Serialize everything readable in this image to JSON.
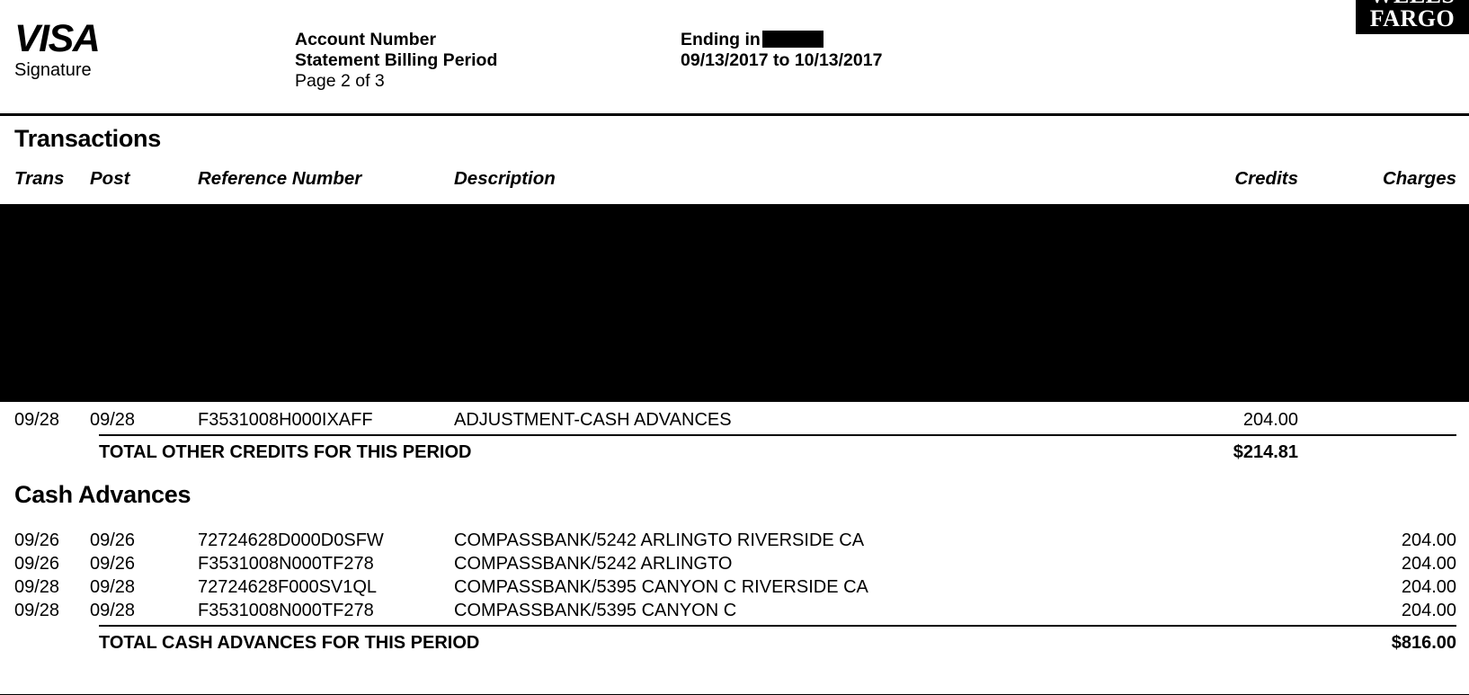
{
  "header": {
    "brand_logo": "visa-signature",
    "visa_wordmark": "VISA",
    "visa_sub": "Signature",
    "labels": {
      "account_number": "Account Number",
      "billing_period": "Statement Billing Period",
      "page": "Page 2 of 3"
    },
    "values": {
      "ending_in_label": "Ending in",
      "ending_in_value": "",
      "date_range": "09/13/2017 to 10/13/2017"
    },
    "bank_logo_line1": "WELLS",
    "bank_logo_line2": "FARGO"
  },
  "transactions_section": {
    "title": "Transactions",
    "columns": {
      "trans": "Trans",
      "post": "Post",
      "reference": "Reference Number",
      "description": "Description",
      "credits": "Credits",
      "charges": "Charges"
    },
    "redacted_rows_note": "",
    "rows": [
      {
        "trans": "09/28",
        "post": "09/28",
        "reference": "F3531008H000IXAFF",
        "description": "ADJUSTMENT-CASH ADVANCES",
        "credits": "204.00",
        "charges": ""
      }
    ],
    "total_label": "TOTAL OTHER CREDITS FOR THIS PERIOD",
    "total_credits": "$214.81",
    "total_charges": ""
  },
  "cash_advances_section": {
    "title": "Cash Advances",
    "rows": [
      {
        "trans": "09/26",
        "post": "09/26",
        "reference": "72724628D000D0SFW",
        "description": "COMPASSBANK/5242 ARLINGTO RIVERSIDE  CA",
        "credits": "",
        "charges": "204.00"
      },
      {
        "trans": "09/26",
        "post": "09/26",
        "reference": "F3531008N000TF278",
        "description": "COMPASSBANK/5242 ARLINGTO",
        "credits": "",
        "charges": "204.00"
      },
      {
        "trans": "09/28",
        "post": "09/28",
        "reference": "72724628F000SV1QL",
        "description": "COMPASSBANK/5395 CANYON C RIVERSIDE  CA",
        "credits": "",
        "charges": "204.00"
      },
      {
        "trans": "09/28",
        "post": "09/28",
        "reference": "F3531008N000TF278",
        "description": "COMPASSBANK/5395 CANYON C",
        "credits": "",
        "charges": "204.00"
      }
    ],
    "total_label": "TOTAL CASH ADVANCES FOR THIS PERIOD",
    "total_credits": "",
    "total_charges": "$816.00"
  },
  "colors": {
    "ink": "#000000",
    "paper": "#ffffff",
    "redaction": "#000000"
  }
}
